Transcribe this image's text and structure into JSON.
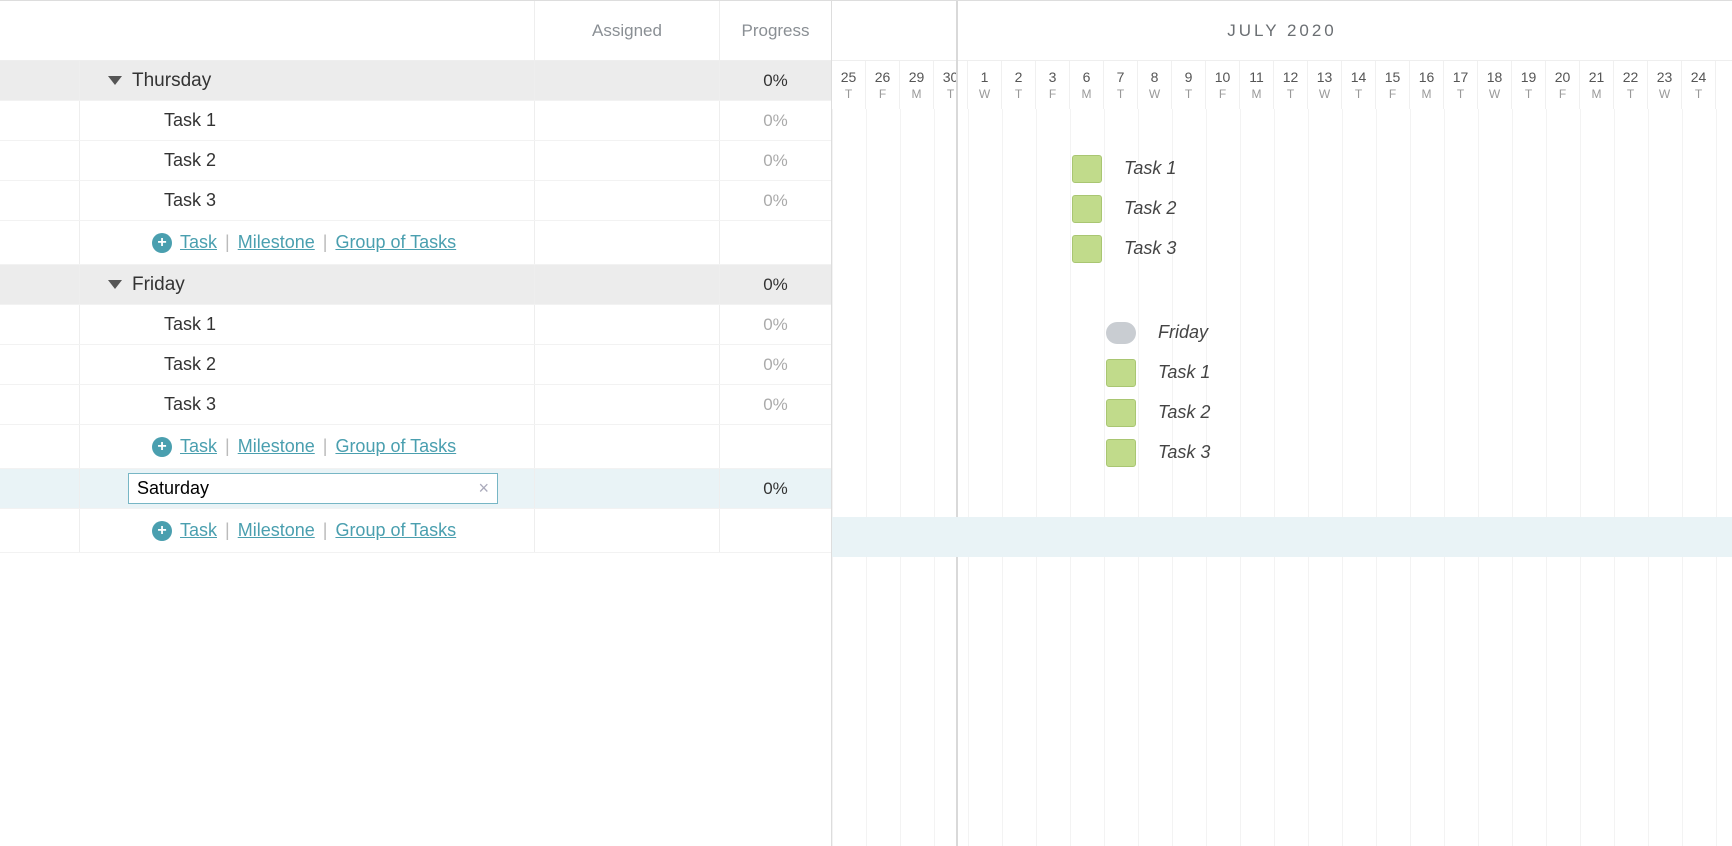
{
  "columns": {
    "assigned": "Assigned",
    "progress": "Progress"
  },
  "timeline": {
    "month": "JULY 2020",
    "dates": [
      {
        "n": "25",
        "w": "T"
      },
      {
        "n": "26",
        "w": "F"
      },
      {
        "n": "29",
        "w": "M"
      },
      {
        "n": "30",
        "w": "T"
      },
      {
        "n": "1",
        "w": "W"
      },
      {
        "n": "2",
        "w": "T"
      },
      {
        "n": "3",
        "w": "F"
      },
      {
        "n": "6",
        "w": "M"
      },
      {
        "n": "7",
        "w": "T"
      },
      {
        "n": "8",
        "w": "W"
      },
      {
        "n": "9",
        "w": "T"
      },
      {
        "n": "10",
        "w": "F"
      },
      {
        "n": "11",
        "w": "M"
      },
      {
        "n": "12",
        "w": "T"
      },
      {
        "n": "13",
        "w": "W"
      },
      {
        "n": "14",
        "w": "T"
      },
      {
        "n": "15",
        "w": "F"
      },
      {
        "n": "16",
        "w": "M"
      },
      {
        "n": "17",
        "w": "T"
      },
      {
        "n": "18",
        "w": "W"
      },
      {
        "n": "19",
        "w": "T"
      },
      {
        "n": "20",
        "w": "F"
      },
      {
        "n": "21",
        "w": "M"
      },
      {
        "n": "22",
        "w": "T"
      },
      {
        "n": "23",
        "w": "W"
      },
      {
        "n": "24",
        "w": "T"
      }
    ],
    "separators_after": [
      1,
      6,
      11,
      16,
      21
    ]
  },
  "add": {
    "task": "Task",
    "milestone": "Milestone",
    "group": "Group of Tasks"
  },
  "groups": [
    {
      "name": "Thursday",
      "progress": "0%",
      "bar_col": null,
      "tasks": [
        {
          "name": "Task 1",
          "progress": "0%",
          "bar_col": 7,
          "label": "Task 1"
        },
        {
          "name": "Task 2",
          "progress": "0%",
          "bar_col": 7,
          "label": "Task 2"
        },
        {
          "name": "Task 3",
          "progress": "0%",
          "bar_col": 7,
          "label": "Task 3"
        }
      ]
    },
    {
      "name": "Friday",
      "progress": "0%",
      "milestone_col": 8,
      "milestone_label": "Friday",
      "tasks": [
        {
          "name": "Task 1",
          "progress": "0%",
          "bar_col": 8,
          "label": "Task 1"
        },
        {
          "name": "Task 2",
          "progress": "0%",
          "bar_col": 8,
          "label": "Task 2"
        },
        {
          "name": "Task 3",
          "progress": "0%",
          "bar_col": 8,
          "label": "Task 3"
        }
      ]
    }
  ],
  "editing": {
    "value": "Saturday",
    "progress": "0%"
  }
}
